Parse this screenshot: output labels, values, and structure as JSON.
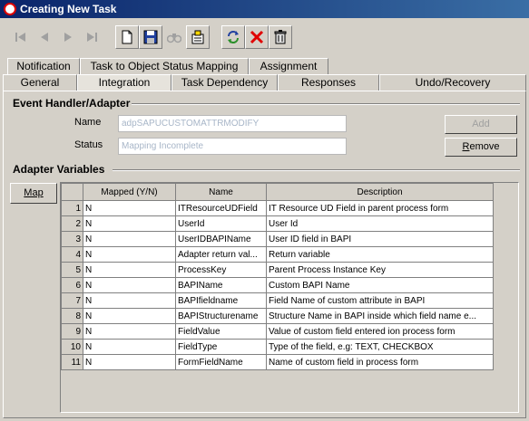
{
  "window": {
    "title": "Creating New Task"
  },
  "toolbar": {
    "buttons": [
      {
        "name": "first-record-icon",
        "enabled": false
      },
      {
        "name": "previous-record-icon",
        "enabled": false
      },
      {
        "name": "next-record-icon",
        "enabled": false
      },
      {
        "name": "last-record-icon",
        "enabled": false
      },
      {
        "name": "new-icon",
        "enabled": true
      },
      {
        "name": "save-icon",
        "enabled": true
      },
      {
        "name": "find-icon",
        "enabled": false
      },
      {
        "name": "query-icon",
        "enabled": true
      },
      {
        "name": "refresh-icon",
        "enabled": true
      },
      {
        "name": "delete-icon",
        "enabled": true
      },
      {
        "name": "trash-icon",
        "enabled": true
      }
    ]
  },
  "tabs": {
    "row1": [
      "Notification",
      "Task to Object Status Mapping",
      "Assignment"
    ],
    "row2": [
      "General",
      "Integration",
      "Task Dependency",
      "Responses",
      "Undo/Recovery"
    ],
    "active": "Integration"
  },
  "event_handler": {
    "section_title": "Event Handler/Adapter",
    "name_label": "Name",
    "name_value": "adpSAPUCUSTOMATTRMODIFY",
    "status_label": "Status",
    "status_value": "Mapping Incomplete",
    "add_label": "Add",
    "remove_label": "Remove"
  },
  "adapter_variables": {
    "section_title": "Adapter Variables",
    "map_label": "Map",
    "columns": [
      "Mapped (Y/N)",
      "Name",
      "Description"
    ],
    "rows": [
      {
        "num": "1",
        "mapped": "N",
        "name": "ITResourceUDField",
        "desc": "IT Resource UD Field in parent process form"
      },
      {
        "num": "2",
        "mapped": "N",
        "name": "UserId",
        "desc": "User Id"
      },
      {
        "num": "3",
        "mapped": "N",
        "name": "UserIDBAPIName",
        "desc": "User ID field in BAPI"
      },
      {
        "num": "4",
        "mapped": "N",
        "name": "Adapter return val...",
        "desc": "Return variable"
      },
      {
        "num": "5",
        "mapped": "N",
        "name": "ProcessKey",
        "desc": "Parent Process Instance Key"
      },
      {
        "num": "6",
        "mapped": "N",
        "name": "BAPIName",
        "desc": "Custom BAPI Name"
      },
      {
        "num": "7",
        "mapped": "N",
        "name": "BAPIfieldname",
        "desc": "Field Name of custom attribute in BAPI"
      },
      {
        "num": "8",
        "mapped": "N",
        "name": "BAPIStructurename",
        "desc": "Structure Name in BAPI inside which field name e..."
      },
      {
        "num": "9",
        "mapped": "N",
        "name": "FieldValue",
        "desc": "Value of custom field entered ion process form"
      },
      {
        "num": "10",
        "mapped": "N",
        "name": "FieldType",
        "desc": "Type of the field, e.g: TEXT, CHECKBOX"
      },
      {
        "num": "11",
        "mapped": "N",
        "name": "FormFieldName",
        "desc": "Name of custom field in process form"
      }
    ]
  }
}
